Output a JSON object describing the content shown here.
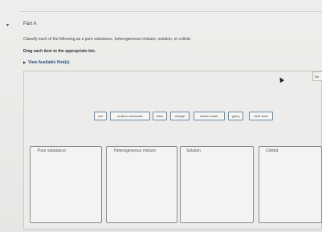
{
  "part_title": "Part A",
  "instructions": "Classify each of the following as a pure substance, heterogeneous mixture, solution, or colloid.",
  "drag_instruction": "Drag each item to the appropriate bin.",
  "hints_link": "View Available Hint(s)",
  "reset_label": "Re",
  "items": [
    "soil",
    "sodium carbonate",
    "ether",
    "vinegar",
    "seltzer water",
    "gravy",
    "beef stew"
  ],
  "bins": [
    "Pure substance",
    "Heterogeneous mixture",
    "Solution",
    "Colloid"
  ]
}
